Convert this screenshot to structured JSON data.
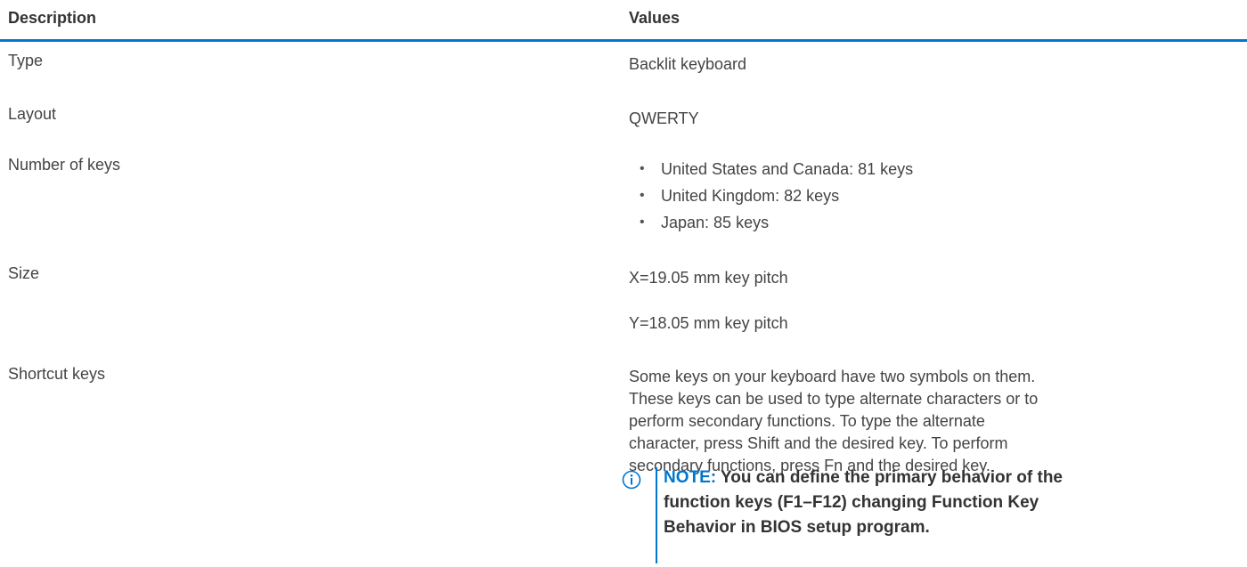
{
  "header": {
    "description": "Description",
    "values": "Values"
  },
  "rows": [
    {
      "description": "Type",
      "value": "Backlit keyboard"
    },
    {
      "description": "Layout",
      "value": "QWERTY"
    },
    {
      "description": "Number of keys",
      "bullets": [
        "United States and Canada: 81 keys",
        "United Kingdom: 82 keys",
        "Japan: 85 keys"
      ]
    },
    {
      "description": "Size",
      "lines": [
        "X=19.05 mm key pitch",
        "Y=18.05 mm key pitch"
      ]
    },
    {
      "description": "Shortcut keys",
      "paragraph": "Some keys on your keyboard have two symbols on them. These keys can be used to type alternate characters or to perform secondary functions. To type the alternate character, press Shift and the desired key. To perform secondary functions, press Fn and the desired key.",
      "note_label": "NOTE:",
      "note_text": " You can define the primary behavior of the function keys (F1–F12) changing Function Key Behavior in BIOS setup program.",
      "note_icon": "info-icon"
    }
  ],
  "colors": {
    "accent": "#0076ce",
    "text": "#444444"
  }
}
